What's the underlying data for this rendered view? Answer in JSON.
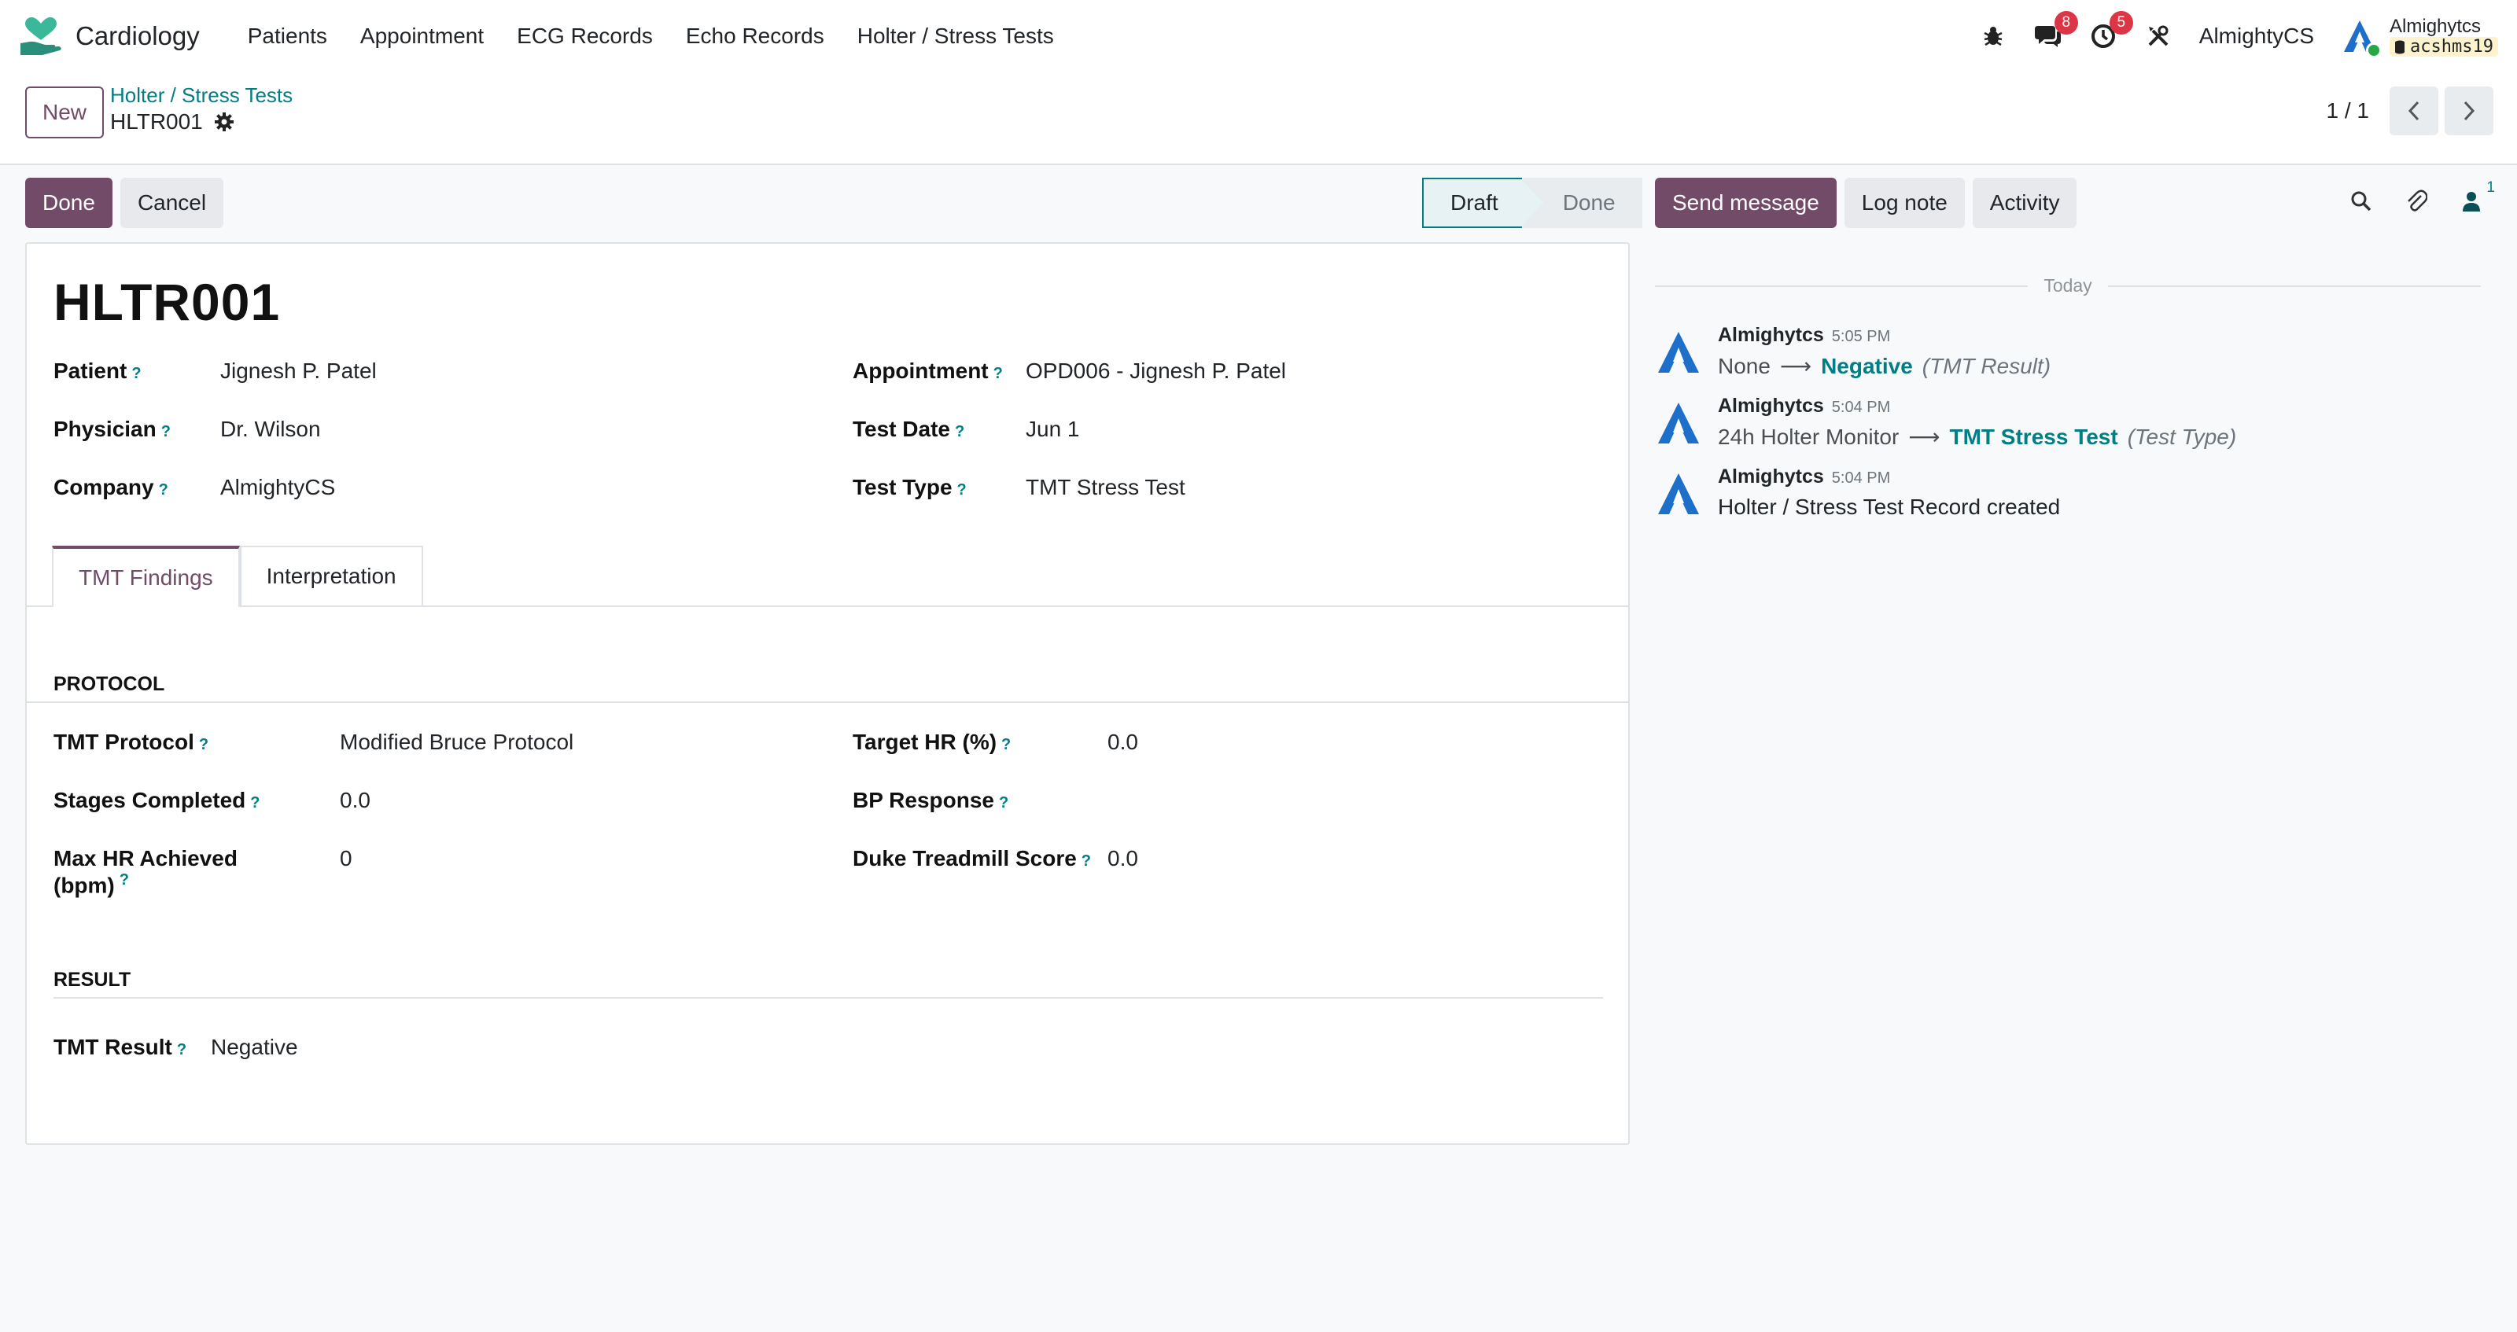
{
  "navbar": {
    "app_name": "Cardiology",
    "menu": [
      "Patients",
      "Appointment",
      "ECG Records",
      "Echo Records",
      "Holter / Stress Tests"
    ],
    "messages_count": "8",
    "activities_count": "5",
    "company": "AlmightyCS",
    "user_name": "Almighytcs",
    "database": "acshms19"
  },
  "control_panel": {
    "new_label": "New",
    "breadcrumb_parent": "Holter / Stress Tests",
    "breadcrumb_current": "HLTR001",
    "pager": "1 / 1"
  },
  "statusbar": {
    "done_button": "Done",
    "cancel_button": "Cancel",
    "stages": [
      "Draft",
      "Done"
    ],
    "current_stage": "Draft"
  },
  "form": {
    "title": "HLTR001",
    "fields": {
      "patient": {
        "label": "Patient",
        "value": "Jignesh P. Patel"
      },
      "physician": {
        "label": "Physician",
        "value": "Dr. Wilson"
      },
      "company": {
        "label": "Company",
        "value": "AlmightyCS"
      },
      "appointment": {
        "label": "Appointment",
        "value": "OPD006 - Jignesh P. Patel"
      },
      "test_date": {
        "label": "Test Date",
        "value": "Jun 1"
      },
      "test_type": {
        "label": "Test Type",
        "value": "TMT Stress Test"
      }
    },
    "tabs": [
      "TMT Findings",
      "Interpretation"
    ],
    "active_tab": "TMT Findings",
    "protocol_section": {
      "title": "PROTOCOL",
      "tmt_protocol": {
        "label": "TMT Protocol",
        "value": "Modified Bruce Protocol"
      },
      "stages_completed": {
        "label": "Stages Completed",
        "value": "0.0"
      },
      "max_hr_line1": "Max HR Achieved",
      "max_hr_line2": "(bpm)",
      "max_hr_value": "0",
      "target_hr": {
        "label": "Target HR (%)",
        "value": "0.0"
      },
      "bp_response": {
        "label": "BP Response",
        "value": ""
      },
      "duke_score": {
        "label": "Duke Treadmill Score",
        "value": "0.0"
      }
    },
    "result_section": {
      "title": "RESULT",
      "tmt_result": {
        "label": "TMT Result",
        "value": "Negative"
      }
    },
    "help_mark": "?"
  },
  "chatter": {
    "send_message": "Send message",
    "log_note": "Log note",
    "activity": "Activity",
    "followers_count": "1",
    "date_separator": "Today",
    "messages": [
      {
        "author": "Almighytcs",
        "time": "5:05 PM",
        "old": "None",
        "new": "Negative",
        "field": "(TMT Result)"
      },
      {
        "author": "Almighytcs",
        "time": "5:04 PM",
        "old": "24h Holter Monitor",
        "new": "TMT Stress Test",
        "field": "(Test Type)"
      },
      {
        "author": "Almighytcs",
        "time": "5:04 PM",
        "text": "Holter / Stress Test Record created"
      }
    ]
  },
  "colors": {
    "primary": "#714b67",
    "accent": "#017e84",
    "badge": "#dc3545"
  }
}
